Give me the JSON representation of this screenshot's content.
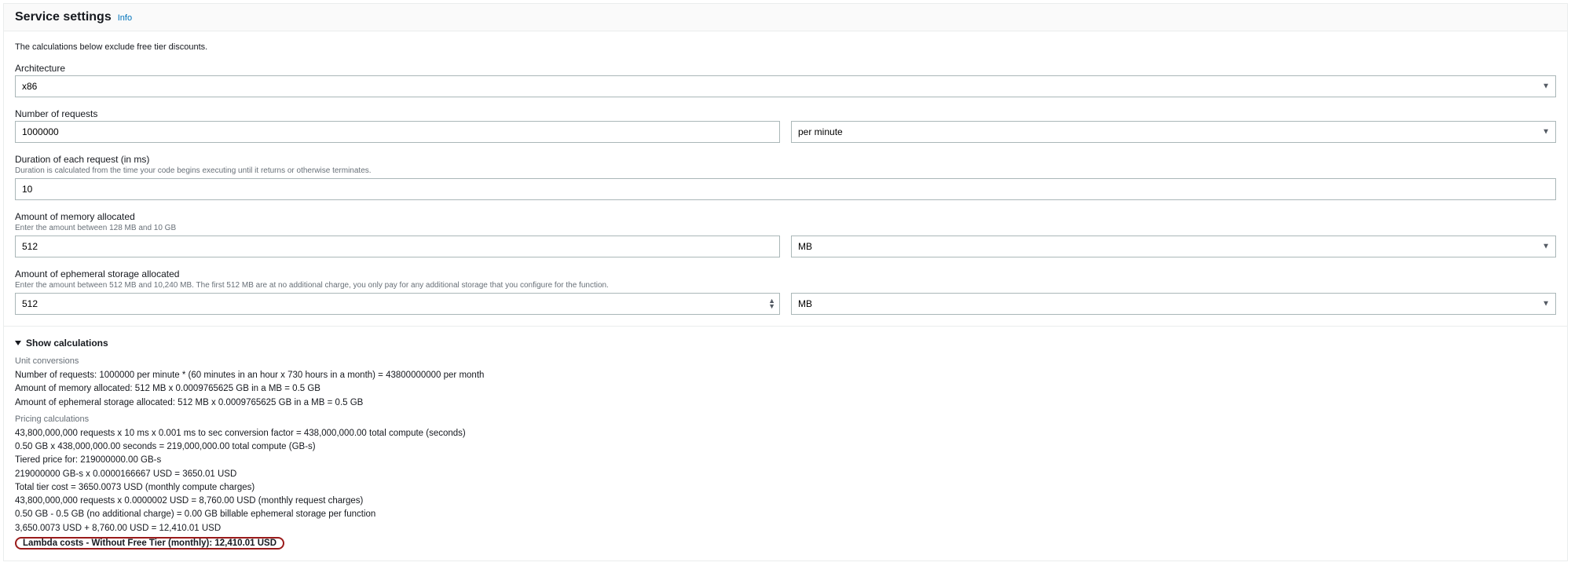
{
  "header": {
    "title": "Service settings",
    "info_label": "Info"
  },
  "note": "The calculations below exclude free tier discounts.",
  "fields": {
    "architecture": {
      "label": "Architecture",
      "value": "x86"
    },
    "requests": {
      "label": "Number of requests",
      "value": "1000000",
      "unit_value": "per minute"
    },
    "duration": {
      "label": "Duration of each request (in ms)",
      "hint": "Duration is calculated from the time your code begins executing until it returns or otherwise terminates.",
      "value": "10"
    },
    "memory": {
      "label": "Amount of memory allocated",
      "hint": "Enter the amount between 128 MB and 10 GB",
      "value": "512",
      "unit_value": "MB"
    },
    "storage": {
      "label": "Amount of ephemeral storage allocated",
      "hint": "Enter the amount between 512 MB and 10,240 MB. The first 512 MB are at no additional charge, you only pay for any additional storage that you configure for the function.",
      "value": "512",
      "unit_value": "MB"
    }
  },
  "calc": {
    "toggle_label": "Show calculations",
    "unit_heading": "Unit conversions",
    "lines_unit": [
      "Number of requests: 1000000 per minute * (60 minutes in an hour x 730 hours in a month) = 43800000000 per month",
      "Amount of memory allocated: 512 MB x 0.0009765625 GB in a MB = 0.5 GB",
      "Amount of ephemeral storage allocated: 512 MB x 0.0009765625 GB in a MB = 0.5 GB"
    ],
    "pricing_heading": "Pricing calculations",
    "lines_pricing": [
      "43,800,000,000 requests x 10 ms x 0.001 ms to sec conversion factor = 438,000,000.00 total compute (seconds)",
      "0.50 GB x 438,000,000.00 seconds = 219,000,000.00 total compute (GB-s)",
      "Tiered price for: 219000000.00 GB-s",
      "219000000 GB-s x 0.0000166667 USD = 3650.01 USD",
      "Total tier cost = 3650.0073 USD (monthly compute charges)",
      "43,800,000,000 requests x 0.0000002 USD = 8,760.00 USD (monthly request charges)",
      "0.50 GB - 0.5 GB (no additional charge) = 0.00 GB billable ephemeral storage per function",
      "3,650.0073 USD + 8,760.00 USD = 12,410.01 USD"
    ],
    "final": "Lambda costs - Without Free Tier (monthly): 12,410.01 USD"
  }
}
